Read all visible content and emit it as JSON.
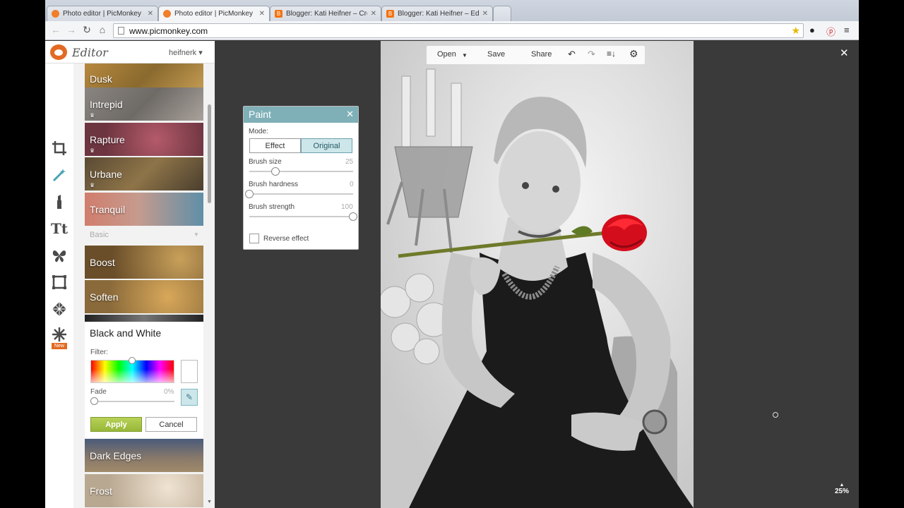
{
  "browser": {
    "tabs": [
      {
        "label": "Photo editor | PicMonkey",
        "icon": "picmonkey-icon",
        "active": false
      },
      {
        "label": "Photo editor | PicMonkey",
        "icon": "picmonkey-icon",
        "active": true
      },
      {
        "label": "Blogger: Kati Heifner – Cre",
        "icon": "blogger-icon",
        "active": false
      },
      {
        "label": "Blogger: Kati Heifner – Edi",
        "icon": "blogger-icon",
        "active": false
      }
    ],
    "url": "www.picmonkey.com"
  },
  "app": {
    "logo_text": "Editor",
    "user": "heifnerk ▾"
  },
  "rail": {
    "new_badge": "New",
    "text_tool": "Tt"
  },
  "effects": {
    "tiles_top": [
      {
        "label": "Dusk",
        "crown": false
      },
      {
        "label": "Intrepid",
        "crown": true
      },
      {
        "label": "Rapture",
        "crown": true
      },
      {
        "label": "Urbane",
        "crown": true
      },
      {
        "label": "Tranquil",
        "crown": false
      }
    ],
    "section": "Basic",
    "tiles_basic": [
      {
        "label": "Boost"
      },
      {
        "label": "Soften"
      }
    ],
    "tiles_bottom": [
      {
        "label": "Dark Edges"
      },
      {
        "label": "Frost"
      }
    ]
  },
  "bw_panel": {
    "title": "Black and White",
    "filter_label": "Filter:",
    "fade_label": "Fade",
    "fade_value": "0%",
    "fade": 0,
    "apply": "Apply",
    "cancel": "Cancel"
  },
  "paint": {
    "title": "Paint",
    "mode_label": "Mode:",
    "mode_effect": "Effect",
    "mode_original": "Original",
    "selected_mode": "Original",
    "brush_size_label": "Brush size",
    "brush_size_value": "25",
    "brush_size": 25,
    "brush_hardness_label": "Brush hardness",
    "brush_hardness_value": "0",
    "brush_hardness": 0,
    "brush_strength_label": "Brush strength",
    "brush_strength_value": "100",
    "brush_strength": 100,
    "reverse_label": "Reverse effect"
  },
  "photo_toolbar": {
    "open": "Open",
    "save": "Save",
    "share": "Share"
  },
  "zoom": "25%",
  "colors": {
    "accent": "#7fb0b8",
    "apply_green": "#a6c447",
    "brand_orange": "#e26a22",
    "rose_red": "#e0101e"
  }
}
